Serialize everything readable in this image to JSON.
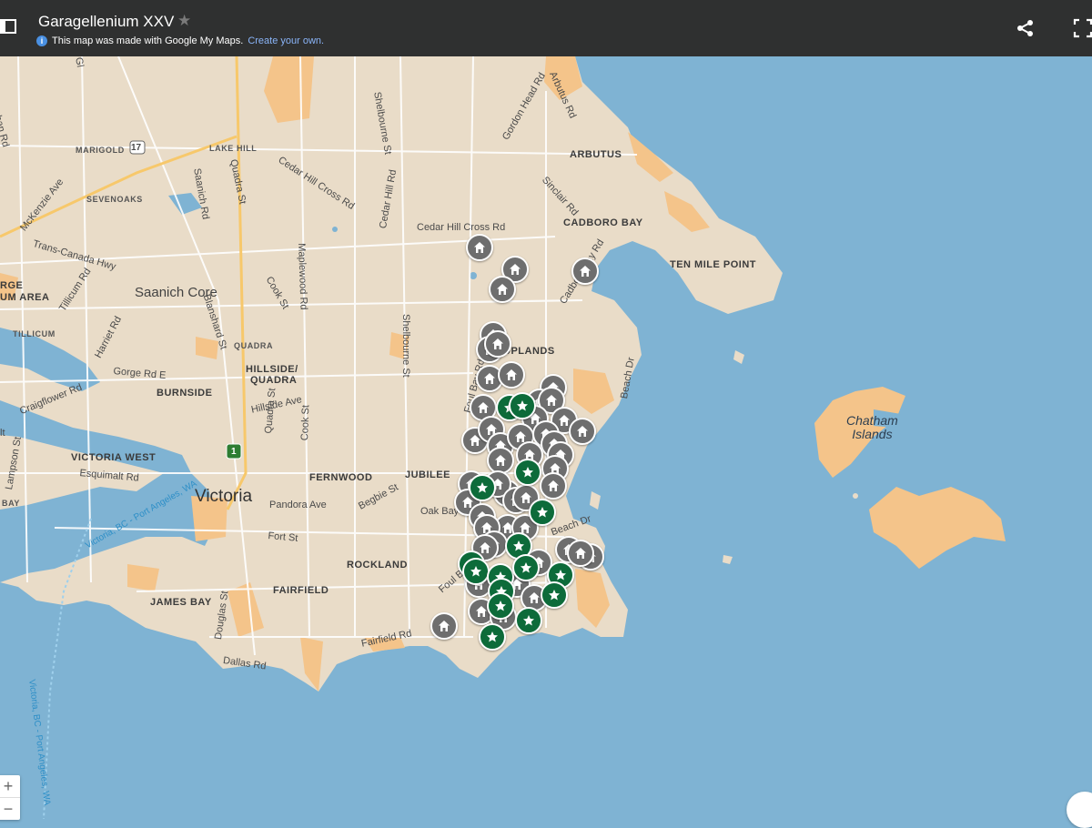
{
  "header": {
    "title": "Garagellenium XXV",
    "made_with": "This map was made with Google My Maps.",
    "create_link": "Create your own."
  },
  "colors": {
    "water": "#7fb3d3",
    "land": "#e9dcc8",
    "park": "#f4c48a",
    "header": "#2f3030",
    "marker_grey": "#6e6e6e",
    "marker_green": "#0d6b3a"
  },
  "icons": {
    "panel": "panel-toggle-icon",
    "star": "star-icon",
    "share": "share-icon",
    "fullscreen": "fullscreen-icon",
    "house": "house-icon",
    "favorite": "star-marker-icon"
  },
  "map_labels": {
    "marigold": "MARIGOLD",
    "lake_hill": "LAKE HILL",
    "sevenoaks": "SEVENOAKS",
    "arbutus": "ARBUTUS",
    "cadboro_bay": "CADBORO BAY",
    "ten_mile_point": "TEN MILE POINT",
    "saanich_core": "Saanich Core",
    "gorge": "RGE",
    "gorge_area": "UM AREA",
    "tillicum": "TILLICUM",
    "quadra": "QUADRA",
    "uplands": "UPLANDS",
    "hillside_quadra_1": "HILLSIDE/",
    "hillside_quadra_2": "QUADRA",
    "burnside": "BURNSIDE",
    "victoria_west": "VICTORIA WEST",
    "fernwood": "FERNWOOD",
    "jubilee": "JUBILEE",
    "victoria": "Victoria",
    "rockland": "ROCKLAND",
    "james_bay": "JAMES BAY",
    "fairfield": "FAIRFIELD",
    "bay": "BAY",
    "chatham_1": "Chatham",
    "chatham_2": "Islands",
    "shelbourne_st": "Shelbourne St",
    "shelbourne_st_2": "Shelbourne St",
    "gordon_head_rd": "Gordon Head Rd",
    "arbutus_rd": "Arbutus Rd",
    "cedar_hill_cross_rd": "Cedar Hill Cross Rd",
    "cedar_hill_cross_rd_2": "Cedar Hill Cross Rd",
    "cedar_hill_rd": "Cedar Hill Rd",
    "sinclair_rd": "Sinclair Rd",
    "cadboro_bay_rd": "Cadboro Bay Rd",
    "mckenzie_ave": "McKenzie Ave",
    "trans_canada": "Trans-Canada Hwy",
    "tillicum_rd": "Tillicum Rd",
    "saanich_rd": "Saanich Rd",
    "quadra_st": "Quadra St",
    "quadra_st_2": "Quadra St",
    "cook_st": "Cook St",
    "cook_st_2": "Cook St",
    "maplewood_rd": "Maplewood Rd",
    "blanshard_st": "Blanshard St",
    "harriet_rd": "Harriet Rd",
    "gorge_rd_e": "Gorge Rd E",
    "craigflower_rd": "Craigflower Rd",
    "hillside_ave": "Hillside Ave",
    "foul_bay_rd": "Foul Bay Rd",
    "foul_bay_rd_2": "Foul Bay Rd",
    "beach_dr": "Beach Dr",
    "beach_dr_2": "Beach Dr",
    "esquimalt_rd": "Esquimalt Rd",
    "lampson_st": "Lampson St",
    "pandora_ave": "Pandora Ave",
    "begbie_st": "Begbie St",
    "fort_st": "Fort St",
    "oak_bay": "Oak Bay",
    "douglas_st": "Douglas St",
    "fairfield_rd": "Fairfield Rd",
    "dallas_rd": "Dallas Rd",
    "ferry_1": "Victoria, BC - Port Angeles, WA",
    "ferry_2": "Victoria, BC - Port Angeles, WA",
    "hwy17": "17",
    "hwy1": "1",
    "it": "lt",
    "n_rd": "rban Rd",
    "gl": "Gl"
  },
  "zoom": {
    "in": "+",
    "out": "−"
  }
}
